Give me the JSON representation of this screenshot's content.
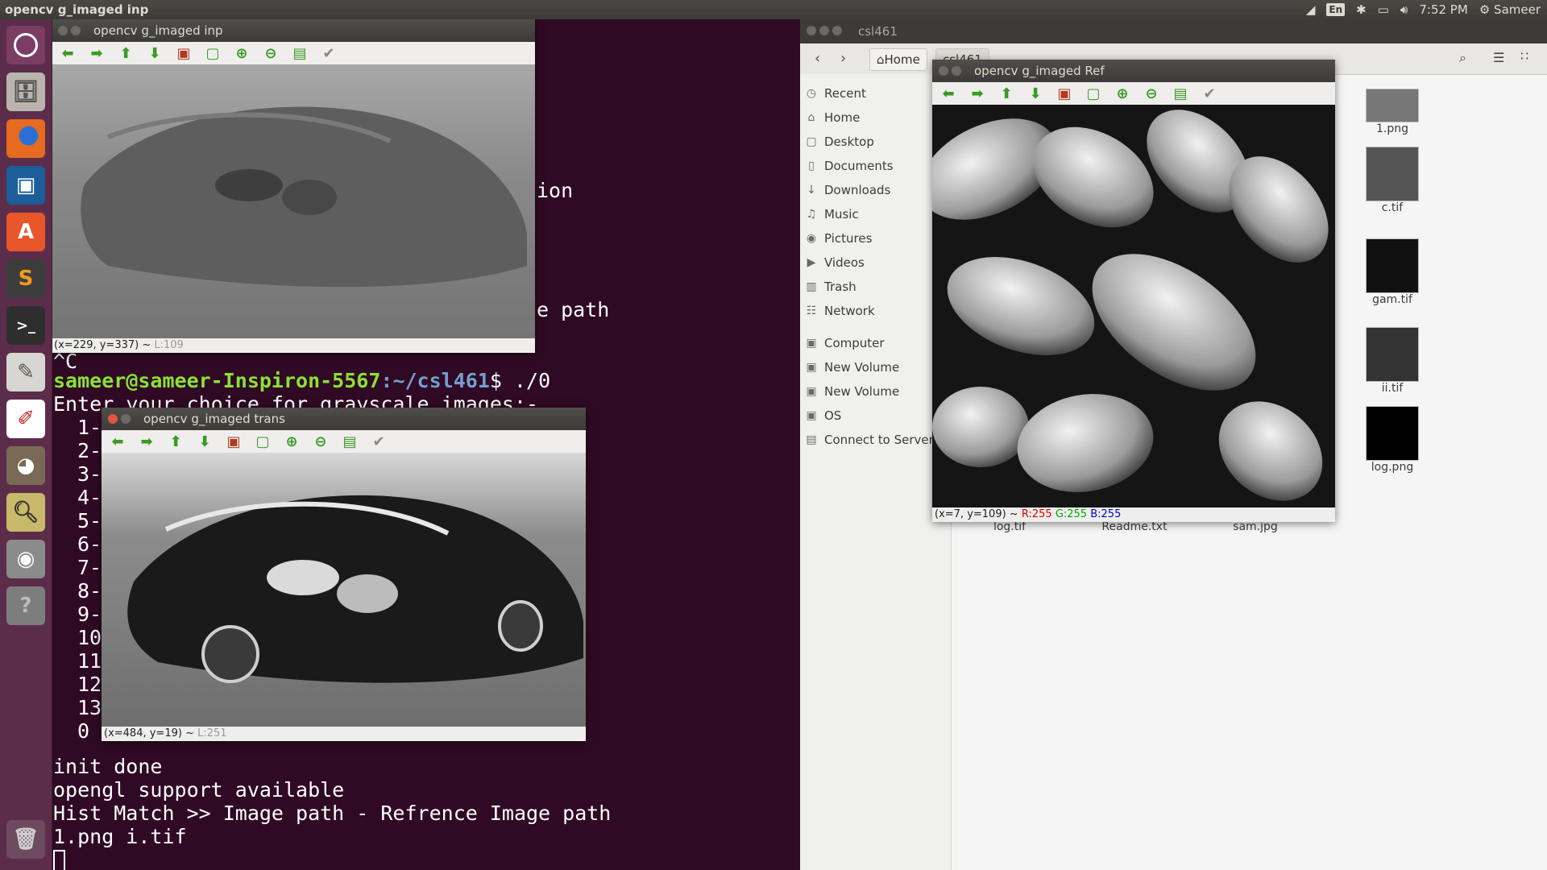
{
  "top_panel": {
    "app_title": "opencv g_imaged inp",
    "keyboard": "En",
    "time": "7:52 PM",
    "user": "Sameer"
  },
  "terminal": {
    "frag_option": "ion",
    "frag_path": "e path",
    "ctrl_c": "^C",
    "prompt_user": "sameer@sameer-Inspiron-5567",
    "prompt_path": ":~/csl461",
    "prompt_cmd": "$ ./0",
    "menu_header": "Enter your choice for grayscale images:-",
    "menu_numbers": [
      "1-",
      "2-",
      "3-",
      "4-",
      "5-",
      "6-",
      "7-",
      "8-",
      "9-",
      "10",
      "11",
      "12",
      "13",
      "0"
    ],
    "out1": "init done",
    "out2": "opengl support available",
    "out3": "Hist Match >> Image path - Refrence Image path",
    "out4": "1.png i.tif"
  },
  "files": {
    "window_title": "csl461",
    "breadcrumb_home": "Home",
    "breadcrumb_current": "csl461",
    "sidebar": [
      {
        "icon": "clock-icon",
        "label": "Recent"
      },
      {
        "icon": "home-icon",
        "label": "Home"
      },
      {
        "icon": "folder-icon",
        "label": "Desktop"
      },
      {
        "icon": "document-icon",
        "label": "Documents"
      },
      {
        "icon": "download-icon",
        "label": "Downloads"
      },
      {
        "icon": "music-icon",
        "label": "Music"
      },
      {
        "icon": "camera-icon",
        "label": "Pictures"
      },
      {
        "icon": "video-icon",
        "label": "Videos"
      },
      {
        "icon": "trash-icon",
        "label": "Trash"
      },
      {
        "icon": "network-icon",
        "label": "Network"
      },
      {
        "icon": "drive-icon",
        "label": "Computer"
      },
      {
        "icon": "drive-icon",
        "label": "New Volume"
      },
      {
        "icon": "drive-icon",
        "label": "New Volume"
      },
      {
        "icon": "drive-icon",
        "label": "OS"
      },
      {
        "icon": "server-icon",
        "label": "Connect to Server"
      }
    ],
    "grid_files": [
      "1.png",
      "c.tif",
      "gam.tif",
      "ii.tif",
      "log.png"
    ],
    "bottom_files": [
      "log.tif",
      "Readme.txt",
      "sam.jpg"
    ]
  },
  "win_inp": {
    "title": "opencv g_imaged inp",
    "status_coords": "(x=229, y=337) ~",
    "status_level": "L:109"
  },
  "win_trans": {
    "title": "opencv g_imaged trans",
    "status_coords": "(x=484, y=19) ~",
    "status_level": "L:251"
  },
  "win_ref": {
    "title": "opencv g_imaged Ref",
    "status_coords": "(x=7, y=109) ~",
    "status_r": "R:255",
    "status_g": "G:255",
    "status_b": "B:255"
  },
  "colors": {
    "terminal_bg": "#300a24",
    "launcher_bg": "#5c2d4a",
    "prompt_user": "#8ae234",
    "prompt_path": "#729fcf",
    "tool_green": "#3a9a25"
  }
}
